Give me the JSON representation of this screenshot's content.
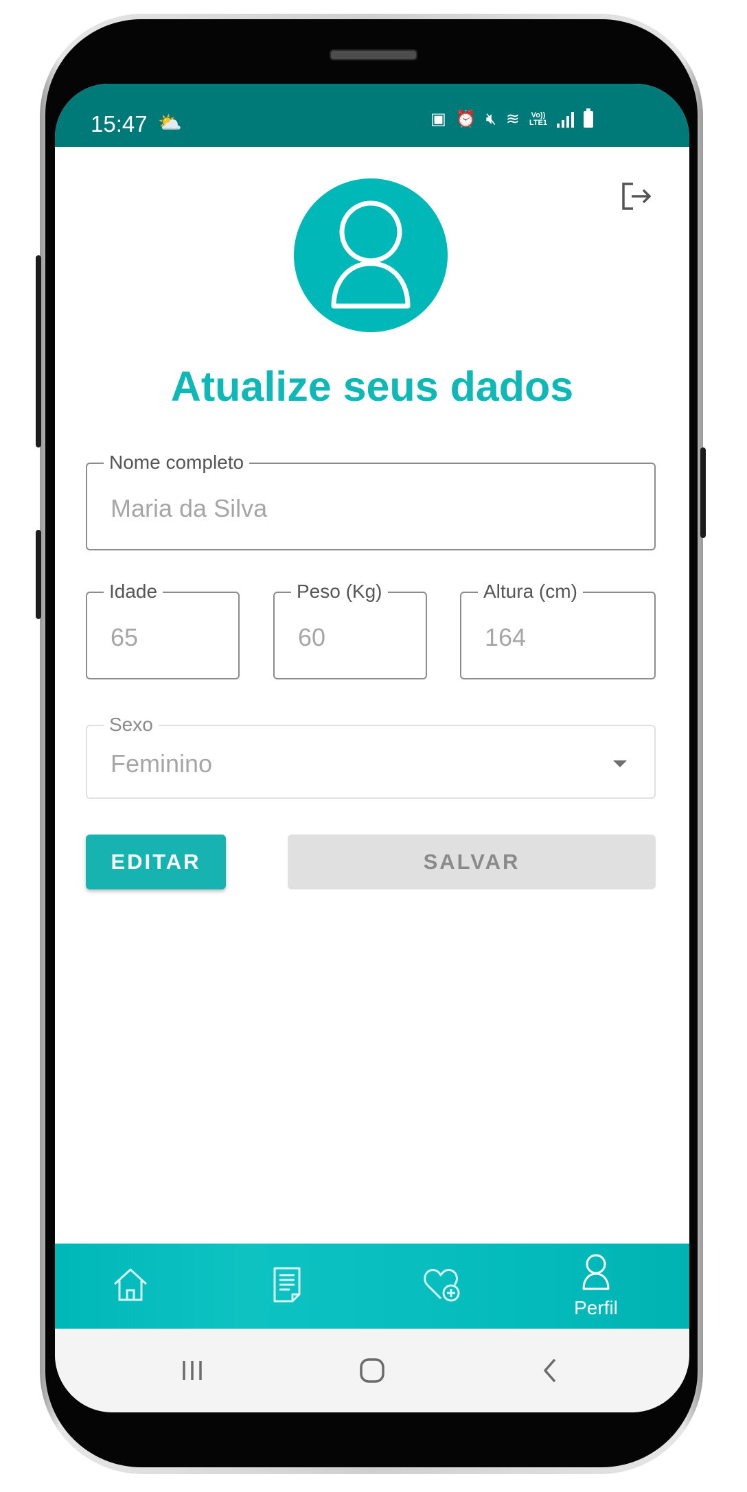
{
  "status_bar": {
    "time": "15:47",
    "lte_top": "Vo))",
    "lte_bottom": "LTE1"
  },
  "header": {
    "title": "Atualize seus dados"
  },
  "form": {
    "full_name": {
      "label": "Nome completo",
      "value": "Maria da Silva"
    },
    "age": {
      "label": "Idade",
      "value": "65"
    },
    "weight": {
      "label": "Peso (Kg)",
      "value": "60"
    },
    "height": {
      "label": "Altura (cm)",
      "value": "164"
    },
    "sex": {
      "label": "Sexo",
      "value": "Feminino"
    }
  },
  "actions": {
    "edit_label": "EDITAR",
    "save_label": "SALVAR"
  },
  "tab_bar": {
    "items": [
      {
        "icon": "home-icon"
      },
      {
        "icon": "document-icon"
      },
      {
        "icon": "heart-plus-icon"
      },
      {
        "icon": "profile-icon",
        "label": "Perfil",
        "active": true
      }
    ]
  },
  "colors": {
    "accent": "#0fb8b6",
    "status_bar": "#007a78",
    "tab_bar": "#00b8b8"
  }
}
